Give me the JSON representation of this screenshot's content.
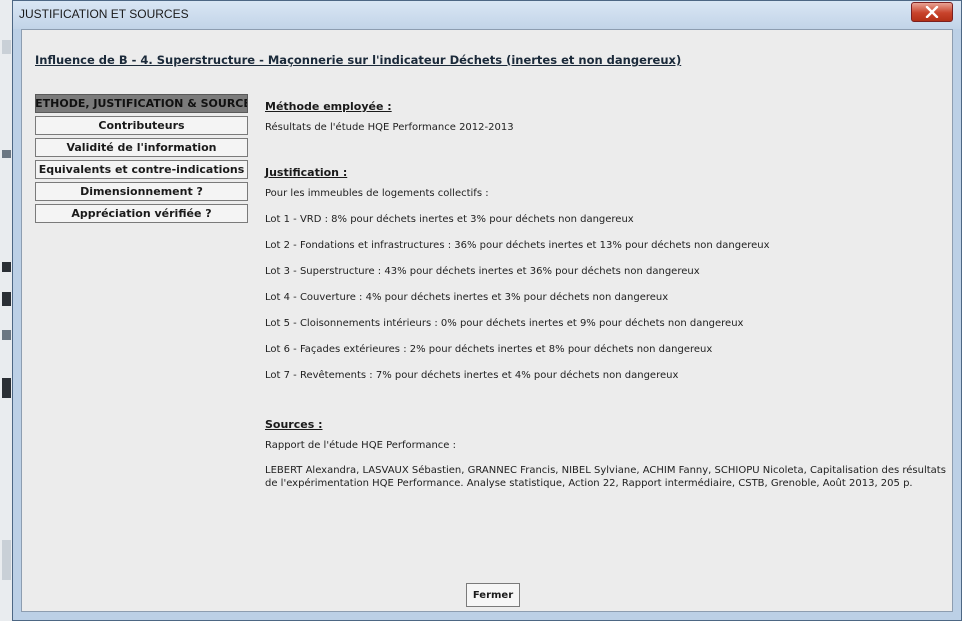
{
  "window": {
    "title": "JUSTIFICATION ET SOURCES"
  },
  "heading": "Influence de B - 4. Superstructure - Maçonnerie sur l'indicateur Déchets (inertes et non dangereux)",
  "menu": [
    {
      "label": "METHODE, JUSTIFICATION & SOURCES",
      "active": true
    },
    {
      "label": "Contributeurs"
    },
    {
      "label": "Validité de l'information"
    },
    {
      "label": "Equivalents et contre-indications"
    },
    {
      "label": "Dimensionnement ?"
    },
    {
      "label": "Appréciation vérifiée ?"
    }
  ],
  "methode": {
    "title": "Méthode employée :",
    "text": "Résultats de l'étude HQE Performance 2012-2013"
  },
  "justification": {
    "title": "Justification :",
    "intro": "Pour les immeubles de logements collectifs :",
    "lots": [
      "Lot 1 - VRD : 8% pour déchets inertes et 3% pour déchets non dangereux",
      "Lot 2 - Fondations et infrastructures : 36% pour déchets inertes et 13% pour déchets non dangereux",
      "Lot 3 - Superstructure : 43% pour déchets inertes et 36% pour déchets non dangereux",
      "Lot 4 - Couverture : 4% pour déchets inertes et 3% pour déchets non dangereux",
      "Lot 5 - Cloisonnements intérieurs : 0% pour déchets inertes et 9% pour déchets non dangereux",
      "Lot 6 - Façades extérieures : 2% pour déchets inertes et 8% pour déchets non dangereux",
      "Lot 7 - Revêtements : 7% pour déchets inertes et 4% pour déchets non dangereux"
    ]
  },
  "sources": {
    "title": "Sources :",
    "intro": "Rapport de l'étude HQE Performance :",
    "citation": "LEBERT Alexandra, LASVAUX Sébastien, GRANNEC Francis, NIBEL Sylviane, ACHIM Fanny, SCHIOPU Nicoleta, Capitalisation des résultats de l'expérimentation HQE Performance. Analyse statistique, Action 22, Rapport intermédiaire, CSTB, Grenoble, Août 2013, 205 p."
  },
  "buttons": {
    "fermer": "Fermer"
  },
  "icons": {
    "close": "close-icon"
  },
  "colors": {
    "close_button": "#c8432b",
    "active_menu": "#7b7b7b",
    "title_bar": "#c2d4e8"
  }
}
